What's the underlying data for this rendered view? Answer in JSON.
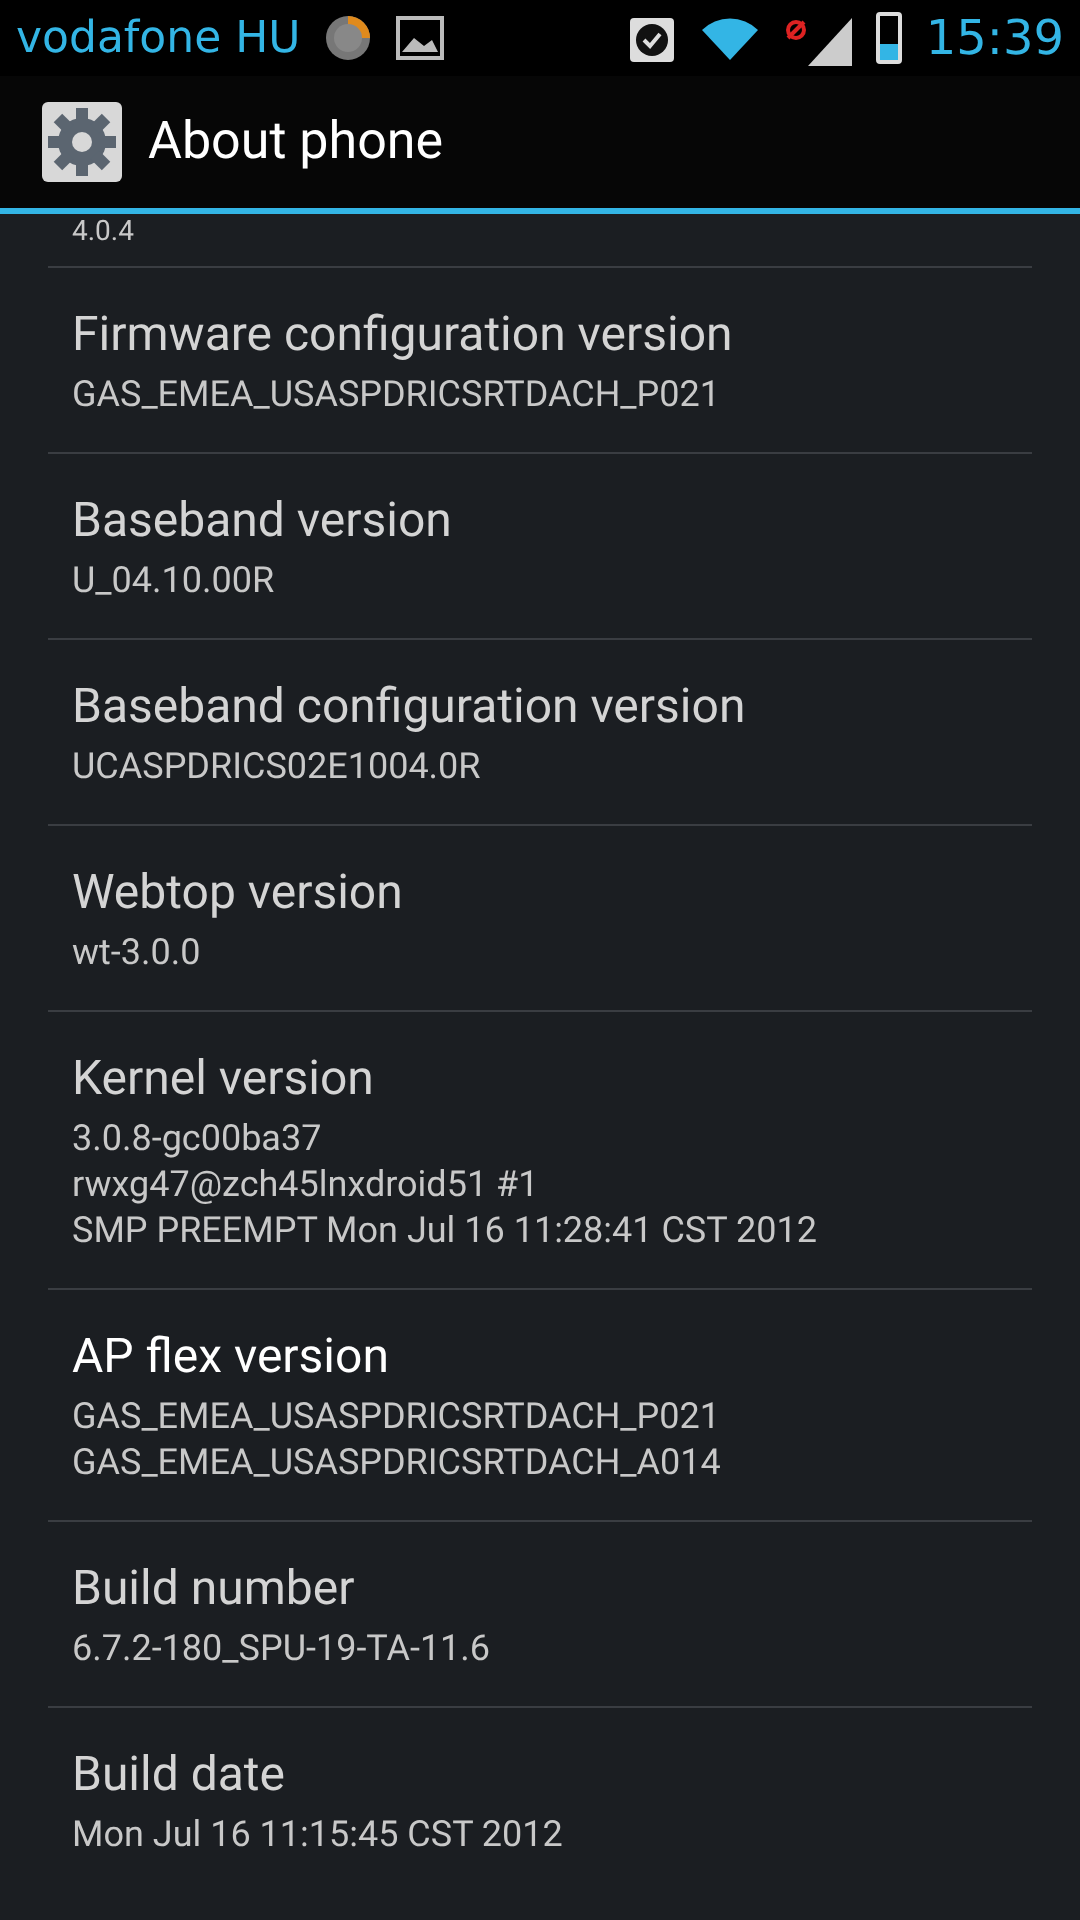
{
  "status_bar": {
    "carrier": "vodafone HU",
    "time": "15:39",
    "battery": {
      "level": 0.35
    }
  },
  "action_bar": {
    "title": "About phone"
  },
  "partial_item": {
    "summary_lines": [
      "4.0.4"
    ]
  },
  "items": [
    {
      "title": "Firmware configuration version",
      "summary_lines": [
        "GAS_EMEA_USASPDRICSRTDACH_P021"
      ],
      "enabled": false
    },
    {
      "title": "Baseband version",
      "summary_lines": [
        "U_04.10.00R"
      ],
      "enabled": false
    },
    {
      "title": "Baseband configuration version",
      "summary_lines": [
        "UCASPDRICS02E1004.0R"
      ],
      "enabled": false
    },
    {
      "title": "Webtop version",
      "summary_lines": [
        "wt-3.0.0"
      ],
      "enabled": false
    },
    {
      "title": "Kernel version",
      "summary_lines": [
        "3.0.8-gc00ba37",
        "rwxg47@zch45lnxdroid51 #1",
        "SMP PREEMPT Mon Jul 16 11:28:41 CST 2012"
      ],
      "enabled": false
    },
    {
      "title": "AP flex version",
      "summary_lines": [
        "GAS_EMEA_USASPDRICSRTDACH_P021",
        "GAS_EMEA_USASPDRICSRTDACH_A014"
      ],
      "enabled": true
    },
    {
      "title": "Build number",
      "summary_lines": [
        "6.7.2-180_SPU-19-TA-11.6"
      ],
      "enabled": false
    },
    {
      "title": "Build date",
      "summary_lines": [
        "Mon Jul 16 11:15:45 CST 2012"
      ],
      "enabled": false
    }
  ]
}
